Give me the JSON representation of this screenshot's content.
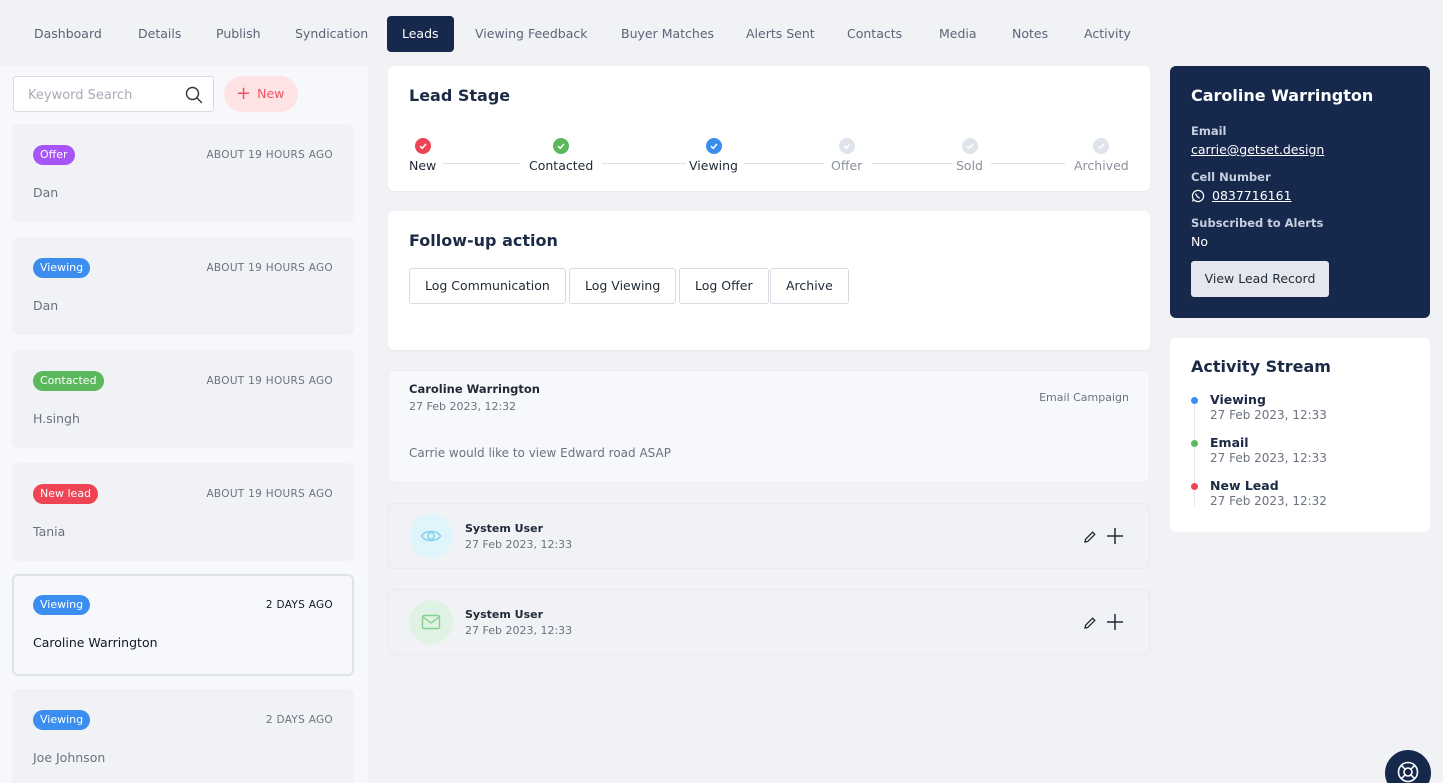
{
  "tabs": [
    {
      "label": "Dashboard",
      "active": false
    },
    {
      "label": "Details",
      "active": false
    },
    {
      "label": "Publish",
      "active": false
    },
    {
      "label": "Syndication",
      "active": false
    },
    {
      "label": "Leads",
      "active": true
    },
    {
      "label": "Viewing Feedback",
      "active": false
    },
    {
      "label": "Buyer Matches",
      "active": false
    },
    {
      "label": "Alerts Sent",
      "active": false
    },
    {
      "label": "Contacts",
      "active": false
    },
    {
      "label": "Media",
      "active": false
    },
    {
      "label": "Notes",
      "active": false
    },
    {
      "label": "Activity",
      "active": false
    }
  ],
  "search": {
    "placeholder": "Keyword Search",
    "value": "",
    "icon": "search-icon"
  },
  "new_button": {
    "label": "New",
    "icon": "plus-icon"
  },
  "leads": [
    {
      "badge": "Offer",
      "badge_color": "#a855f7",
      "time": "ABOUT 19 HOURS AGO",
      "name": "Dan",
      "selected": false
    },
    {
      "badge": "Viewing",
      "badge_color": "#3b8ef0",
      "time": "ABOUT 19 HOURS AGO",
      "name": "Dan",
      "selected": false
    },
    {
      "badge": "Contacted",
      "badge_color": "#5cb85c",
      "time": "ABOUT 19 HOURS AGO",
      "name": "H.singh",
      "selected": false
    },
    {
      "badge": "New lead",
      "badge_color": "#ef4454",
      "time": "ABOUT 19 HOURS AGO",
      "name": "Tania",
      "selected": false
    },
    {
      "badge": "Viewing",
      "badge_color": "#3b8ef0",
      "time": "2 DAYS AGO",
      "name": "Caroline Warrington",
      "selected": true
    },
    {
      "badge": "Viewing",
      "badge_color": "#3b8ef0",
      "time": "2 DAYS AGO",
      "name": "Joe Johnson",
      "selected": false
    }
  ],
  "lead_stage": {
    "title": "Lead Stage",
    "stages": [
      {
        "label": "New",
        "status": "done",
        "color": "#ef4454"
      },
      {
        "label": "Contacted",
        "status": "done",
        "color": "#5cb85c"
      },
      {
        "label": "Viewing",
        "status": "current",
        "color": "#3b8ef0"
      },
      {
        "label": "Offer",
        "status": "pending",
        "color": "#dfe3ea"
      },
      {
        "label": "Sold",
        "status": "pending",
        "color": "#dfe3ea"
      },
      {
        "label": "Archived",
        "status": "pending",
        "color": "#dfe3ea"
      }
    ]
  },
  "follow_up": {
    "title": "Follow-up action",
    "actions": [
      "Log Communication",
      "Log Viewing",
      "Log Offer",
      "Archive"
    ]
  },
  "comment": {
    "author": "Caroline Warrington",
    "date": "27 Feb 2023, 12:32",
    "source": "Email Campaign",
    "message": "Carrie would like to view Edward road ASAP"
  },
  "system_events": [
    {
      "user": "System User",
      "date": "27 Feb 2023, 12:33",
      "icon": "eye-icon",
      "icon_bg": "#dff4fb",
      "icon_color": "#7fd1ea"
    },
    {
      "user": "System User",
      "date": "27 Feb 2023, 12:33",
      "icon": "mail-icon",
      "icon_bg": "#e0f2e3",
      "icon_color": "#86cf93"
    }
  ],
  "contact": {
    "name": "Caroline Warrington",
    "email_label": "Email",
    "email": "carrie@getset.design",
    "cell_label": "Cell Number",
    "cell": "0837716161",
    "cell_icon": "whatsapp-icon",
    "subscribed_label": "Subscribed to Alerts",
    "subscribed": "No",
    "view_button": "View Lead Record"
  },
  "activity_stream": {
    "title": "Activity Stream",
    "items": [
      {
        "title": "Viewing",
        "date": "27 Feb 2023, 12:33",
        "color": "#3b8ef0"
      },
      {
        "title": "Email",
        "date": "27 Feb 2023, 12:33",
        "color": "#5cb85c"
      },
      {
        "title": "New Lead",
        "date": "27 Feb 2023, 12:32",
        "color": "#ef4454"
      }
    ]
  },
  "colors": {
    "navy": "#16294d",
    "accent_red": "#ee5563"
  },
  "help_button": {
    "icon": "lifebuoy-icon"
  }
}
